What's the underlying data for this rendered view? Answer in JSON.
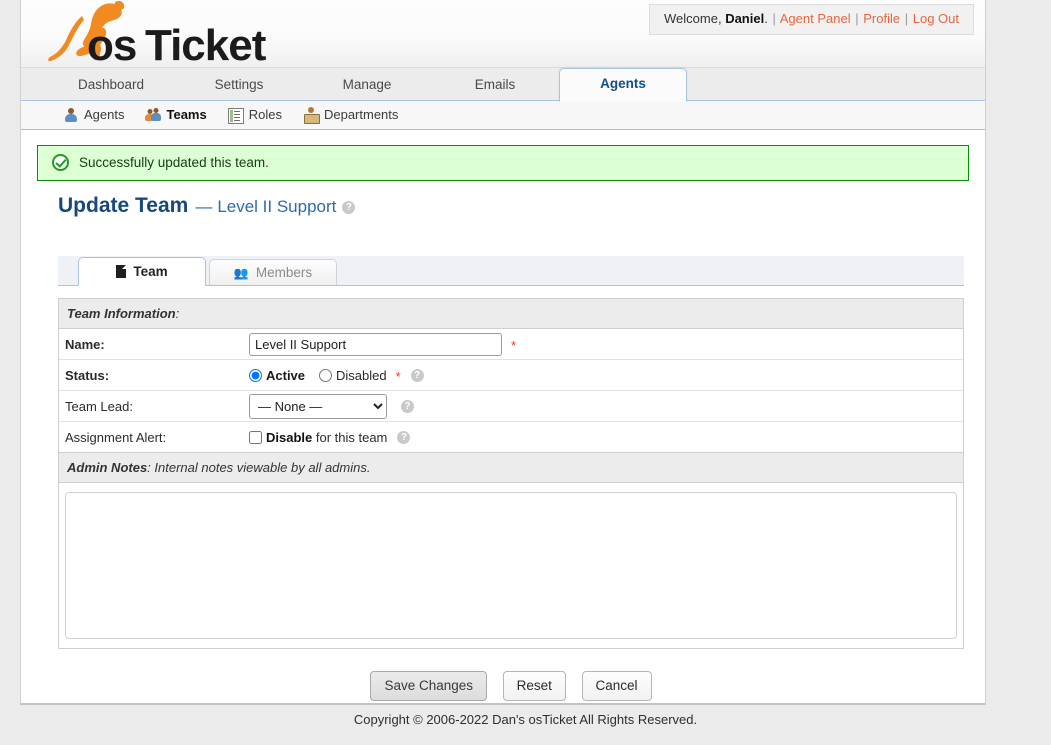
{
  "header": {
    "logo_text": "osTicket",
    "welcome": {
      "greeting": "Welcome,",
      "username": "Daniel",
      "period": ".",
      "separator": "|",
      "agent_panel": "Agent Panel",
      "profile": "Profile",
      "logout": "Log Out"
    }
  },
  "nav_main": {
    "items": [
      {
        "label": "Dashboard",
        "active": false
      },
      {
        "label": "Settings",
        "active": false
      },
      {
        "label": "Manage",
        "active": false
      },
      {
        "label": "Emails",
        "active": false
      },
      {
        "label": "Agents",
        "active": true
      }
    ]
  },
  "nav_sub": {
    "items": [
      {
        "label": "Agents",
        "icon": "person-icon",
        "active": false
      },
      {
        "label": "Teams",
        "icon": "people-icon",
        "active": true
      },
      {
        "label": "Roles",
        "icon": "list-icon",
        "active": false
      },
      {
        "label": "Departments",
        "icon": "department-icon",
        "active": false
      }
    ]
  },
  "alert": {
    "icon": "success-check-icon",
    "message": "Successfully updated this team."
  },
  "page": {
    "title": "Update Team",
    "dash": "—",
    "subject": "Level II Support",
    "help_icon": "?"
  },
  "tabs": [
    {
      "label": "Team",
      "icon": "document-icon",
      "active": true
    },
    {
      "label": "Members",
      "icon": "group-icon",
      "active": false
    }
  ],
  "form": {
    "section_title_bold": "Team Information",
    "section_title_rest": ":",
    "required_mark": "*",
    "rows": {
      "name": {
        "label": "Name:",
        "value": "Level II Support",
        "placeholder": ""
      },
      "status": {
        "label": "Status:",
        "option_active": "Active",
        "option_disabled": "Disabled",
        "selected": "Active"
      },
      "team_lead": {
        "label": "Team Lead:",
        "selected": "— None —",
        "options": [
          "— None —"
        ]
      },
      "assignment_alert": {
        "label": "Assignment Alert:",
        "checkbox_bold": "Disable",
        "checkbox_rest": " for this team",
        "checked": false
      }
    }
  },
  "notes": {
    "title_bold": "Admin Notes",
    "title_rest": ": Internal notes viewable by all admins.",
    "value": "",
    "placeholder": ""
  },
  "actions": {
    "save": "Save Changes",
    "reset": "Reset",
    "cancel": "Cancel"
  },
  "footer": {
    "copyright": "Copyright © 2006-2022 Dan's osTicket All Rights Reserved."
  }
}
